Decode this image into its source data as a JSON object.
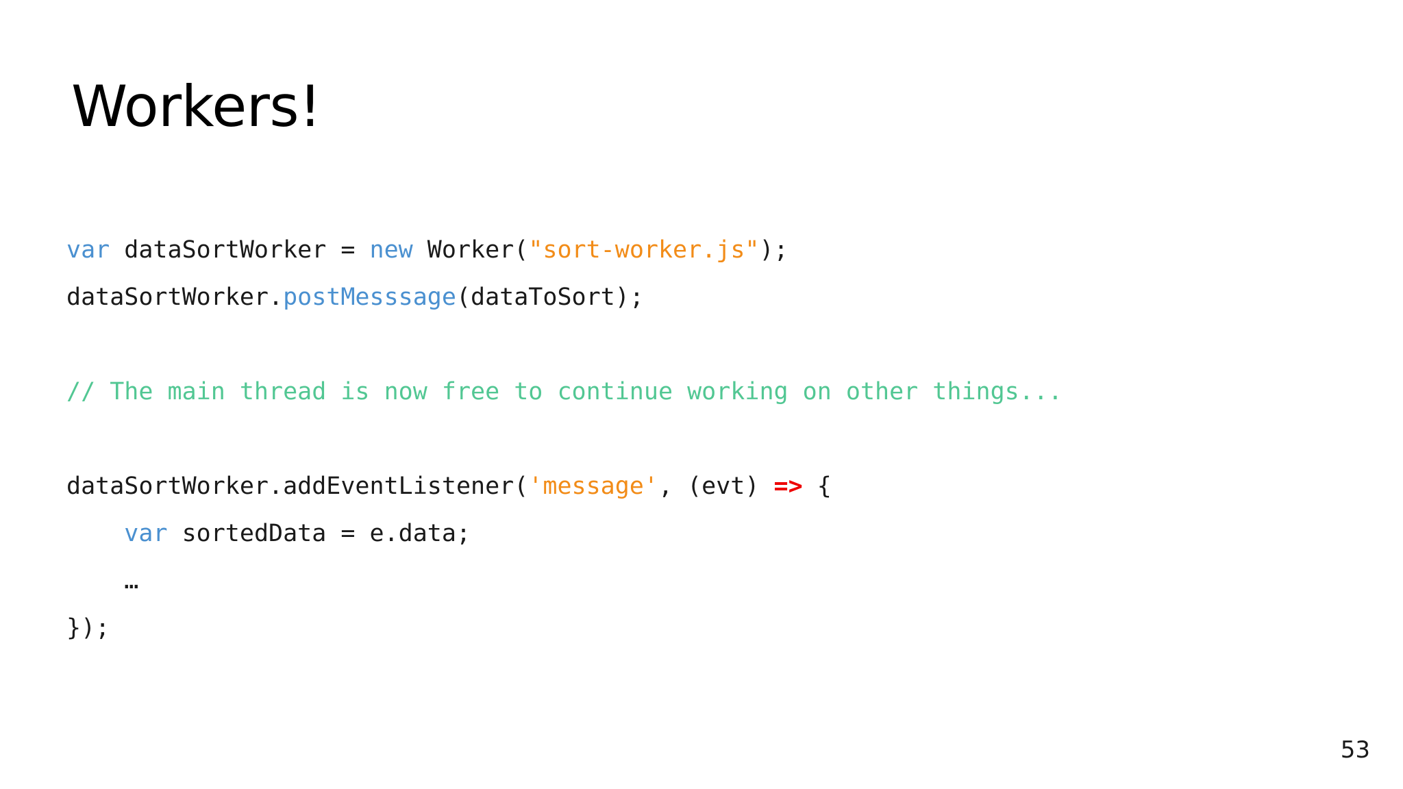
{
  "slide": {
    "title": "Workers!",
    "page_number": "53",
    "background_color": "#ffffff"
  },
  "colors": {
    "plain": "#1a1a1a",
    "keyword": "#4a90d0",
    "function": "#4a90d0",
    "string": "#f28c18",
    "comment": "#52c793",
    "arrow": "#ee0000"
  },
  "code": {
    "language": "javascript",
    "lines": [
      {
        "id": "line-1",
        "text": "var dataSortWorker = new Worker(\"sort-worker.js\");",
        "tokens": [
          {
            "t": "var",
            "c": "keyword"
          },
          {
            "t": " dataSortWorker = ",
            "c": "plain"
          },
          {
            "t": "new",
            "c": "keyword"
          },
          {
            "t": " Worker(",
            "c": "plain"
          },
          {
            "t": "\"sort-worker.js\"",
            "c": "string"
          },
          {
            "t": ");",
            "c": "plain"
          }
        ]
      },
      {
        "id": "line-2",
        "text": "dataSortWorker.postMesssage(dataToSort);",
        "tokens": [
          {
            "t": "dataSortWorker.",
            "c": "plain"
          },
          {
            "t": "postMesssage",
            "c": "function"
          },
          {
            "t": "(dataToSort);",
            "c": "plain"
          }
        ]
      },
      {
        "id": "line-3",
        "text": "",
        "tokens": []
      },
      {
        "id": "line-4",
        "text": "// The main thread is now free to continue working on other things...",
        "tokens": [
          {
            "t": "// The main thread is now free to continue working on other things...",
            "c": "comment"
          }
        ]
      },
      {
        "id": "line-5",
        "text": "",
        "tokens": []
      },
      {
        "id": "line-6",
        "text": "dataSortWorker.addEventListener('message', (evt) => {",
        "tokens": [
          {
            "t": "dataSortWorker.addEventListener(",
            "c": "plain"
          },
          {
            "t": "'message'",
            "c": "string"
          },
          {
            "t": ", (evt) ",
            "c": "plain"
          },
          {
            "t": "=>",
            "c": "arrow"
          },
          {
            "t": " {",
            "c": "plain"
          }
        ]
      },
      {
        "id": "line-7",
        "text": "    var sortedData = e.data;",
        "tokens": [
          {
            "t": "    ",
            "c": "plain"
          },
          {
            "t": "var",
            "c": "keyword"
          },
          {
            "t": " sortedData = e.data;",
            "c": "plain"
          }
        ]
      },
      {
        "id": "line-8",
        "text": "    …",
        "tokens": [
          {
            "t": "    …",
            "c": "plain"
          }
        ]
      },
      {
        "id": "line-9",
        "text": "});",
        "tokens": [
          {
            "t": "});",
            "c": "plain"
          }
        ]
      }
    ]
  }
}
